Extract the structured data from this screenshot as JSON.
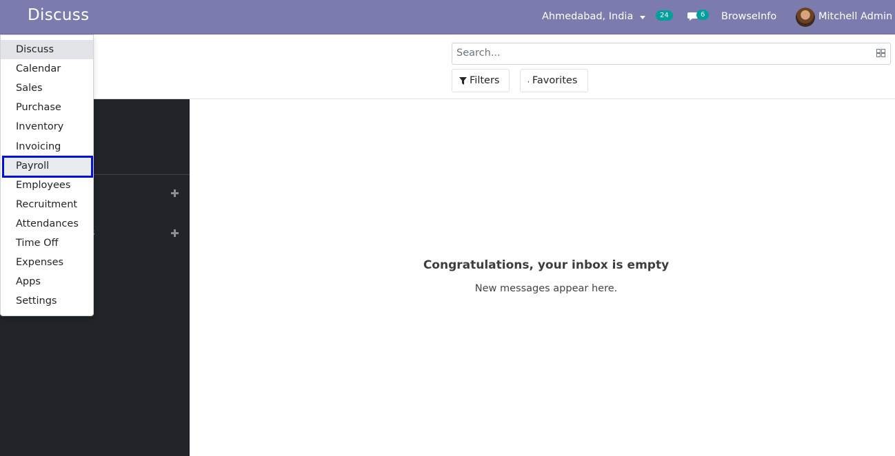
{
  "navbar": {
    "app_title": "Discuss",
    "company": "Ahmedabad, India",
    "activity_count": "24",
    "chat_count": "6",
    "browseinfo": "BrowseInfo",
    "user": "Mitchell Admin",
    "colors": {
      "background": "#7c7bad",
      "badge": "#00a09d"
    }
  },
  "control_panel": {
    "search_placeholder": "Search...",
    "filters_label": "Filters",
    "favorites_label": "Favorites"
  },
  "sidebar": {
    "partial_label": "s"
  },
  "main": {
    "empty_title": "Congratulations, your inbox is empty",
    "empty_subtitle": "New messages appear here."
  },
  "app_menu": {
    "items": [
      "Discuss",
      "Calendar",
      "Sales",
      "Purchase",
      "Inventory",
      "Invoicing",
      "Payroll",
      "Employees",
      "Recruitment",
      "Attendances",
      "Time Off",
      "Expenses",
      "Apps",
      "Settings"
    ],
    "active": "Discuss",
    "highlighted": "Payroll"
  }
}
